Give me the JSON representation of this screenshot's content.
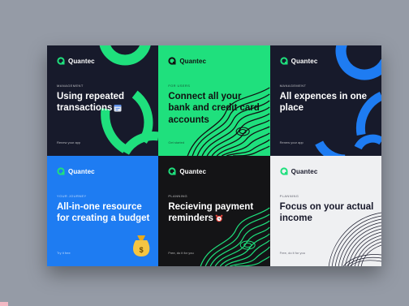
{
  "brand": "Quantec",
  "cards": [
    {
      "category": "MANAGEMENT",
      "headline": "Using repeated transactions",
      "footer": "Renew your app",
      "icon": "calendar-icon"
    },
    {
      "category": "FOR USERS",
      "headline": "Connect all your bank and credit card accounts",
      "footer": "Get started",
      "icon": "none"
    },
    {
      "category": "MANAGEMENT",
      "headline": "All expences in one place",
      "footer": "Renew your app",
      "icon": "none"
    },
    {
      "category": "YOUR JOURNEY",
      "headline": "All-in-one resource for creating a budget",
      "footer": "Try it free",
      "icon": "money-bag-icon"
    },
    {
      "category": "PLANNING",
      "headline": "Recieving payment reminders",
      "footer": "Free, do it for you",
      "icon": "alarm-clock-icon"
    },
    {
      "category": "PLANNING",
      "headline": "Focus on your actual income",
      "footer": "Free, do it for you",
      "icon": "none"
    }
  ],
  "colors": {
    "navy": "#171a2b",
    "green": "#1fe07d",
    "blue": "#1e7cf2",
    "black": "#141416",
    "white": "#eff0f2",
    "background": "#959ba6"
  }
}
